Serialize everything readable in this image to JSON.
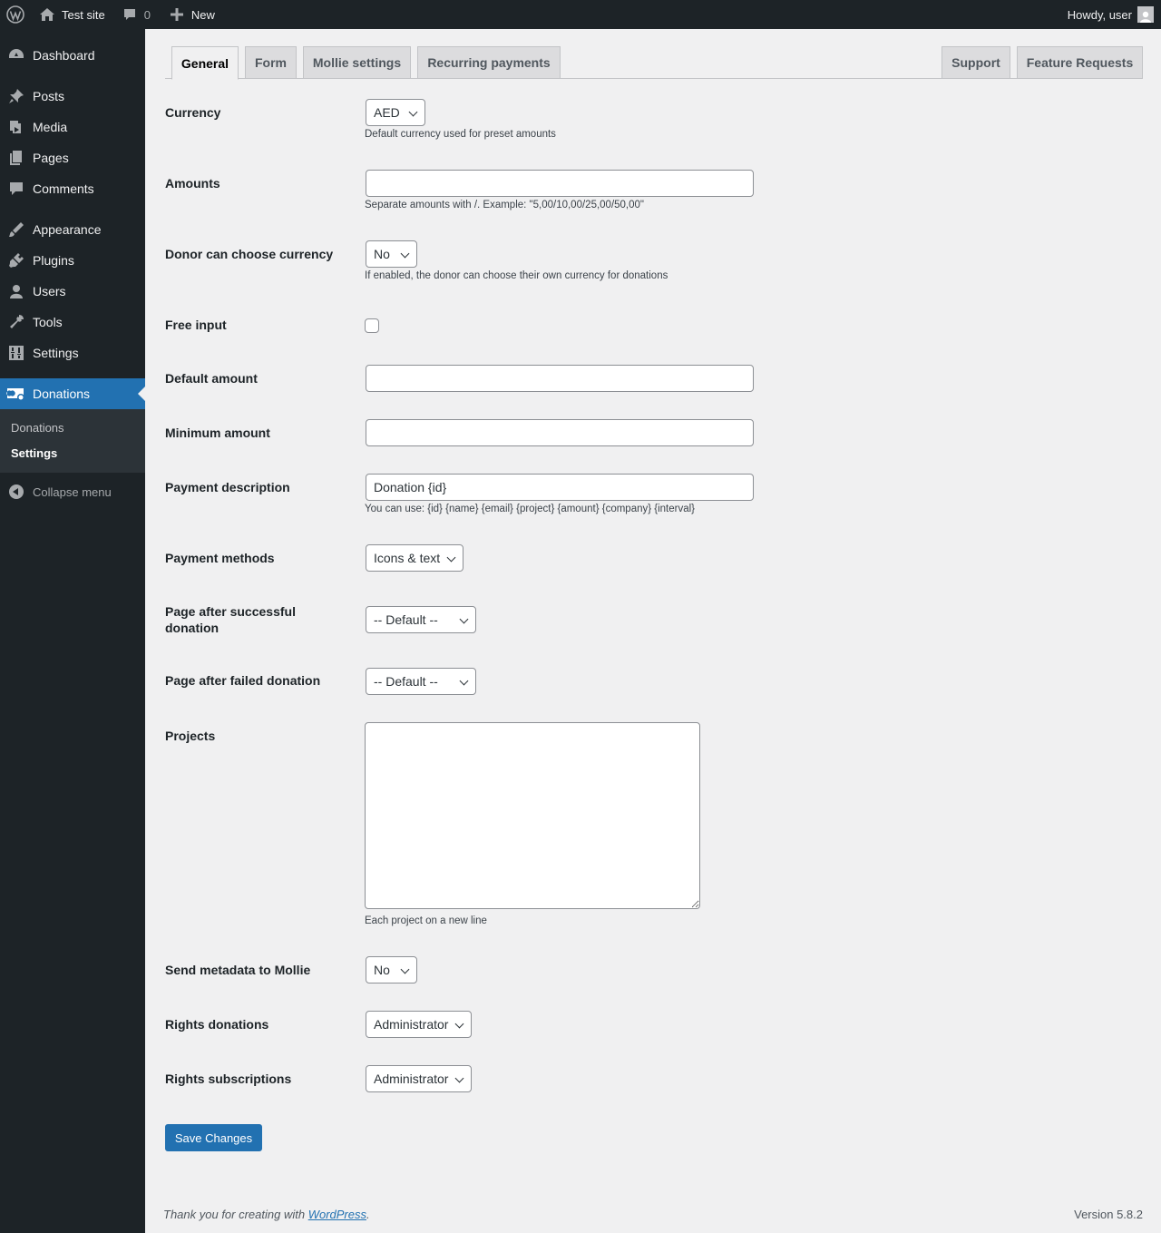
{
  "adminbar": {
    "site_name": "Test site",
    "comments_count": "0",
    "new_label": "New",
    "howdy": "Howdy, user"
  },
  "sidebar": {
    "items": [
      {
        "label": "Dashboard",
        "icon": "dashboard-icon"
      },
      {
        "label": "Posts",
        "icon": "pin-icon"
      },
      {
        "label": "Media",
        "icon": "media-icon"
      },
      {
        "label": "Pages",
        "icon": "pages-icon"
      },
      {
        "label": "Comments",
        "icon": "comment-icon"
      },
      {
        "label": "Appearance",
        "icon": "brush-icon"
      },
      {
        "label": "Plugins",
        "icon": "plug-icon"
      },
      {
        "label": "Users",
        "icon": "user-icon"
      },
      {
        "label": "Tools",
        "icon": "wrench-icon"
      },
      {
        "label": "Settings",
        "icon": "sliders-icon"
      },
      {
        "label": "Donations",
        "icon": "donation-icon"
      }
    ],
    "submenu": [
      "Donations",
      "Settings"
    ],
    "collapse": "Collapse menu"
  },
  "tabs": {
    "general": "General",
    "form": "Form",
    "mollie": "Mollie settings",
    "recurring": "Recurring payments",
    "support": "Support",
    "feature": "Feature Requests"
  },
  "form": {
    "currency": {
      "label": "Currency",
      "value": "AED",
      "desc": "Default currency used for preset amounts"
    },
    "amounts": {
      "label": "Amounts",
      "value": "",
      "desc": "Separate amounts with /. Example: \"5,00/10,00/25,00/50,00\""
    },
    "donor_currency": {
      "label": "Donor can choose currency",
      "value": "No",
      "desc": "If enabled, the donor can choose their own currency for donations"
    },
    "free_input": {
      "label": "Free input",
      "checked": false
    },
    "default_amount": {
      "label": "Default amount",
      "value": ""
    },
    "minimum_amount": {
      "label": "Minimum amount",
      "value": ""
    },
    "payment_description": {
      "label": "Payment description",
      "value": "Donation {id}",
      "desc": "You can use: {id} {name} {email} {project} {amount} {company} {interval}"
    },
    "payment_methods": {
      "label": "Payment methods",
      "value": "Icons & text"
    },
    "page_success": {
      "label": "Page after successful donation",
      "value": "-- Default --"
    },
    "page_failed": {
      "label": "Page after failed donation",
      "value": "-- Default --"
    },
    "projects": {
      "label": "Projects",
      "value": "",
      "desc": "Each project on a new line"
    },
    "send_metadata": {
      "label": "Send metadata to Mollie",
      "value": "No"
    },
    "rights_donations": {
      "label": "Rights donations",
      "value": "Administrator"
    },
    "rights_subscriptions": {
      "label": "Rights subscriptions",
      "value": "Administrator"
    },
    "save": "Save Changes"
  },
  "footer": {
    "thanks_prefix": "Thank you for creating with ",
    "thanks_link": "WordPress",
    "thanks_suffix": ".",
    "version": "Version 5.8.2"
  },
  "colors": {
    "adminbar_bg": "#1d2327",
    "accent": "#2271b1",
    "page_bg": "#f0f0f1"
  }
}
